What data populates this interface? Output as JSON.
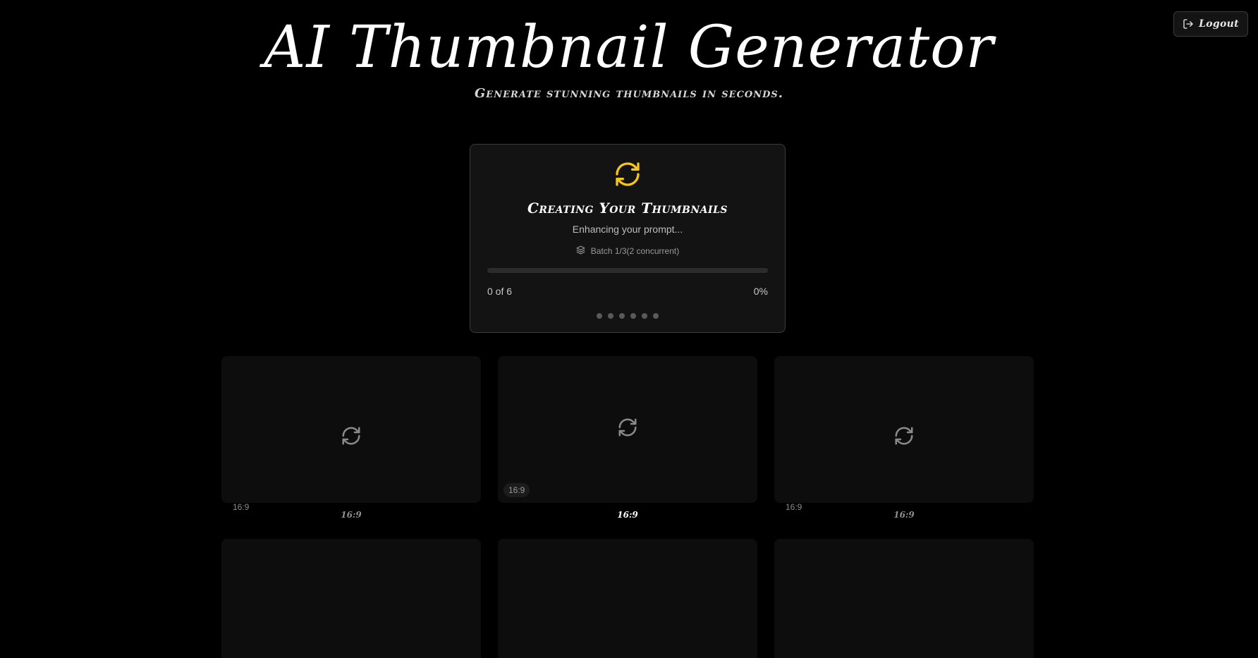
{
  "header": {
    "logout_label": "Logout",
    "title": "AI Thumbnail Generator",
    "subtitle": "Generate stunning thumbnails in seconds."
  },
  "progress": {
    "title": "Creating Your Thumbnails",
    "status": "Enhancing your prompt...",
    "batch": "Batch 1/3(2 concurrent)",
    "count_text": "0 of 6",
    "percent_text": "0%",
    "progress_fraction": 0,
    "accent_color": "#f5c518"
  },
  "thumbnails": [
    {
      "corner_label": "16:9",
      "ratio_label": "16:9"
    },
    {
      "corner_label": "16:9",
      "ratio_label": "16:9"
    },
    {
      "corner_label": "16:9",
      "ratio_label": "16:9"
    },
    {},
    {},
    {}
  ],
  "icons": {
    "logout": "logout-icon",
    "progress": "refresh-icon",
    "batch": "layers-icon",
    "thumbnail_loader": "refresh-icon"
  }
}
